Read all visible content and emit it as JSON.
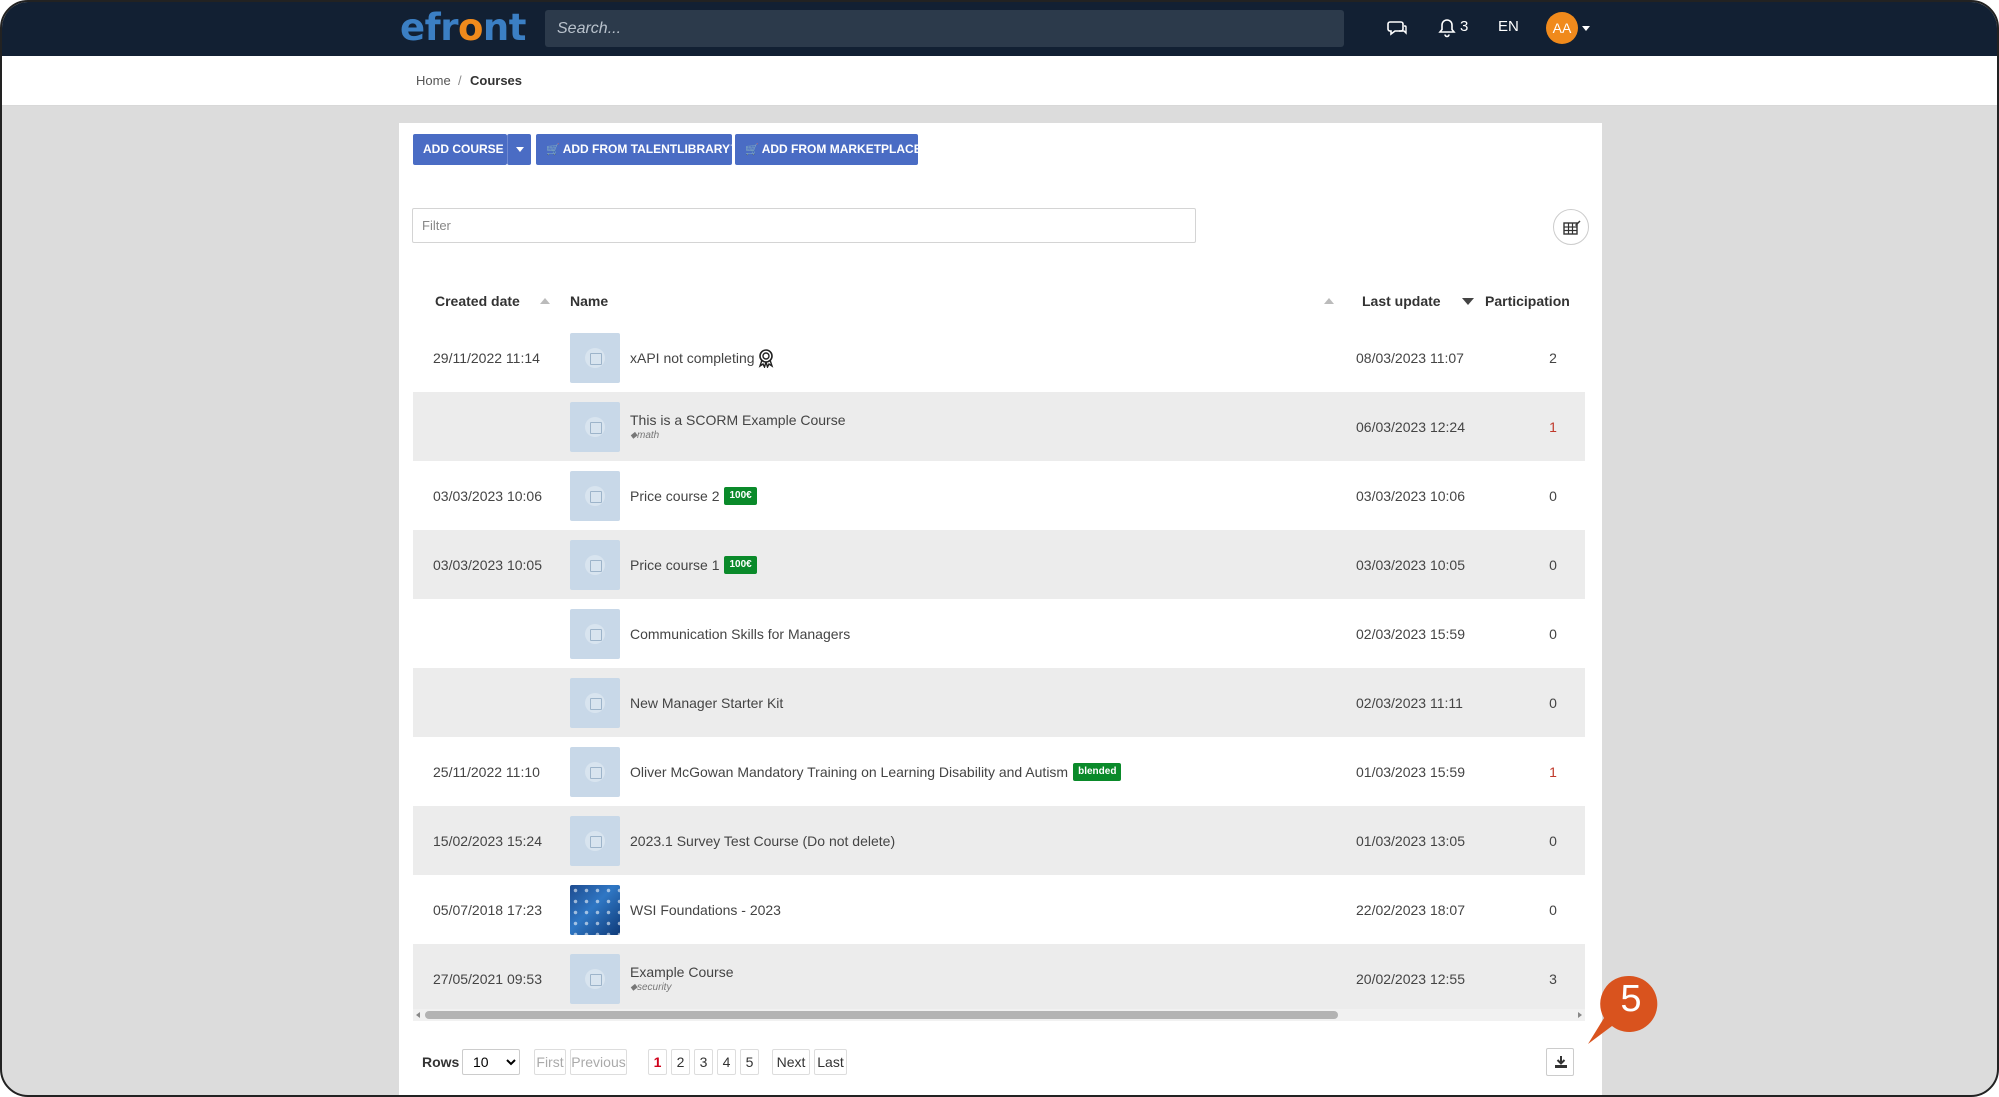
{
  "app": {
    "logo_pre": "efr",
    "logo_o": "o",
    "logo_post": "nt"
  },
  "topbar": {
    "search_placeholder": "Search...",
    "notifications_count": "3",
    "language": "EN",
    "avatar_initials": "AA"
  },
  "breadcrumb": {
    "home": "Home",
    "separator": "/",
    "current": "Courses"
  },
  "toolbar": {
    "add_course": "ADD COURSE",
    "add_talentlibrary": "ADD FROM TALENTLIBRARY™",
    "add_marketplace": "ADD FROM MARKETPLACE"
  },
  "filter": {
    "placeholder": "Filter"
  },
  "table": {
    "headers": {
      "created": "Created date",
      "name": "Name",
      "last_update": "Last update",
      "participation": "Participation"
    },
    "rows": [
      {
        "created": "29/11/2022 11:14",
        "name": "xAPI not completing",
        "tag": "",
        "badge": "",
        "award": true,
        "last_update": "08/03/2023 11:07",
        "participation": "2",
        "link": false,
        "thumb": "book"
      },
      {
        "created": "",
        "name": "This is a SCORM Example Course",
        "tag": "math",
        "badge": "",
        "award": false,
        "last_update": "06/03/2023 12:24",
        "participation": "1",
        "link": true,
        "thumb": "book"
      },
      {
        "created": "03/03/2023 10:06",
        "name": "Price course 2",
        "tag": "",
        "badge": "100€",
        "award": false,
        "last_update": "03/03/2023 10:06",
        "participation": "0",
        "link": false,
        "thumb": "book"
      },
      {
        "created": "03/03/2023 10:05",
        "name": "Price course 1",
        "tag": "",
        "badge": "100€",
        "award": false,
        "last_update": "03/03/2023 10:05",
        "participation": "0",
        "link": false,
        "thumb": "book"
      },
      {
        "created": "",
        "name": "Communication Skills for Managers",
        "tag": "",
        "badge": "",
        "award": false,
        "last_update": "02/03/2023 15:59",
        "participation": "0",
        "link": false,
        "thumb": "book"
      },
      {
        "created": "",
        "name": "New Manager Starter Kit",
        "tag": "",
        "badge": "",
        "award": false,
        "last_update": "02/03/2023 11:11",
        "participation": "0",
        "link": false,
        "thumb": "book"
      },
      {
        "created": "25/11/2022 11:10",
        "name": "Oliver McGowan Mandatory Training on Learning Disability and Autism",
        "tag": "",
        "badge": "blended",
        "award": false,
        "last_update": "01/03/2023 15:59",
        "participation": "1",
        "link": true,
        "thumb": "book"
      },
      {
        "created": "15/02/2023 15:24",
        "name": "2023.1 Survey Test Course (Do not delete)",
        "tag": "",
        "badge": "",
        "award": false,
        "last_update": "01/03/2023 13:05",
        "participation": "0",
        "link": false,
        "thumb": "book"
      },
      {
        "created": "05/07/2018 17:23",
        "name": "WSI Foundations - 2023",
        "tag": "",
        "badge": "",
        "award": false,
        "last_update": "22/02/2023 18:07",
        "participation": "0",
        "link": false,
        "thumb": "image"
      },
      {
        "created": "27/05/2021 09:53",
        "name": "Example Course",
        "tag": "security",
        "badge": "",
        "award": false,
        "last_update": "20/02/2023 12:55",
        "participation": "3",
        "link": false,
        "thumb": "book"
      }
    ]
  },
  "pager": {
    "rows_label": "Rows",
    "rows_value": "10",
    "first": "First",
    "previous": "Previous",
    "pages": [
      "1",
      "2",
      "3",
      "4",
      "5"
    ],
    "active_page": "1",
    "next": "Next",
    "last": "Last"
  },
  "callout": {
    "number": "5",
    "color": "#d9531e"
  },
  "colors": {
    "topbar": "#122033",
    "button": "#4a6cc4",
    "badge": "#0a8a2a",
    "accent": "#f08a1c"
  }
}
